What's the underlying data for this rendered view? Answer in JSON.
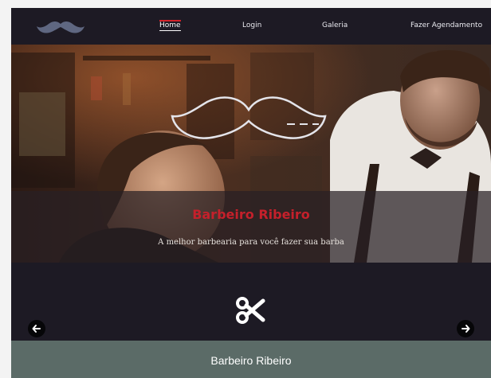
{
  "nav": {
    "logo_icon": "mustache-icon",
    "items": [
      {
        "label": "Home",
        "active": true
      },
      {
        "label": "Login",
        "active": false
      },
      {
        "label": "Galeria",
        "active": false
      },
      {
        "label": "Fazer Agendamento",
        "active": false
      }
    ]
  },
  "hero": {
    "title": "Barbeiro Ribeiro",
    "subtitle": "A melhor barbearia para você fazer sua barba",
    "icon": "mustache-outline-icon"
  },
  "service": {
    "icon": "scissors-icon",
    "prev_icon": "arrow-left-icon",
    "next_icon": "arrow-right-icon"
  },
  "footer": {
    "title": "Barbeiro Ribeiro"
  },
  "colors": {
    "nav_bg": "#1d1a24",
    "accent_red": "#c5202b",
    "footer_bg": "#5b6b67",
    "logo": "#5f6781"
  }
}
